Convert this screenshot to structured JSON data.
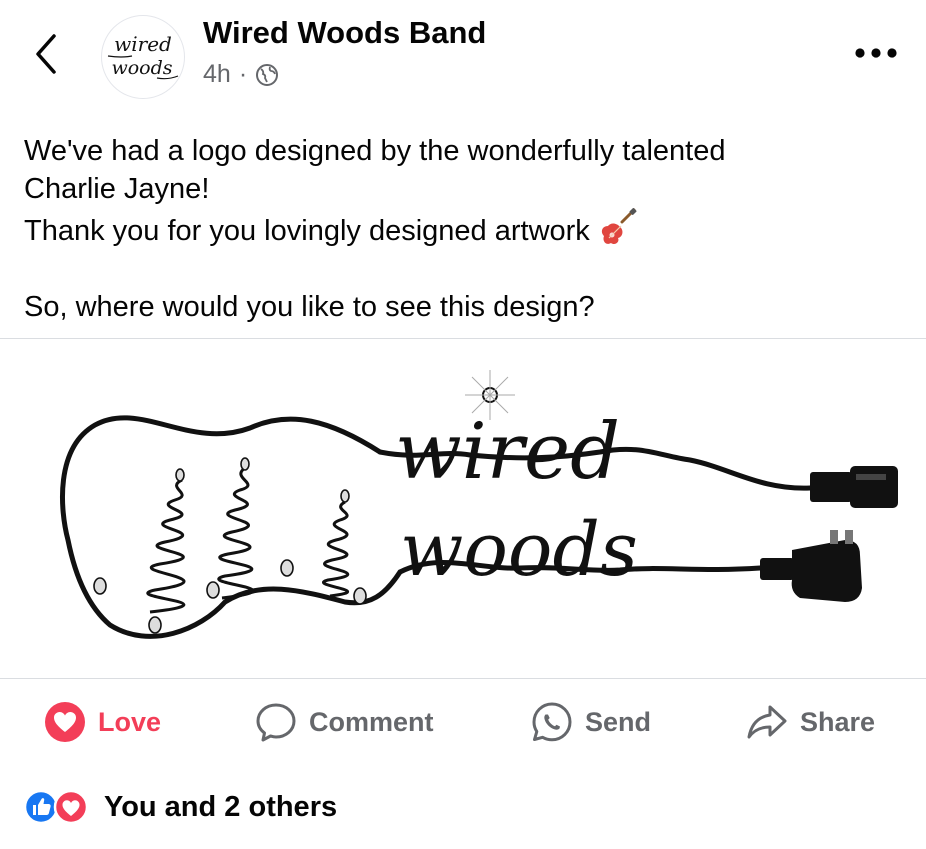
{
  "header": {
    "page_name": "Wired Woods Band",
    "timestamp": "4h",
    "separator": "·",
    "audience_icon": "globe-icon",
    "avatar_text_line1": "wired",
    "avatar_text_line2": "woods"
  },
  "post": {
    "lines": [
      "We've had a logo designed by the wonderfully talented",
      "Charlie Jayne!",
      "Thank you for you lovingly designed artwork"
    ],
    "question": "So, where would you like to see this design?",
    "image_text_line1": "wired",
    "image_text_line2": "woods"
  },
  "actions": {
    "love_label": "Love",
    "comment_label": "Comment",
    "send_label": "Send",
    "share_label": "Share"
  },
  "reactions": {
    "summary": "You and 2 others"
  },
  "colors": {
    "love": "#f33e58",
    "like": "#1877f2",
    "secondary_text": "#65676b",
    "primary_text": "#050505"
  }
}
